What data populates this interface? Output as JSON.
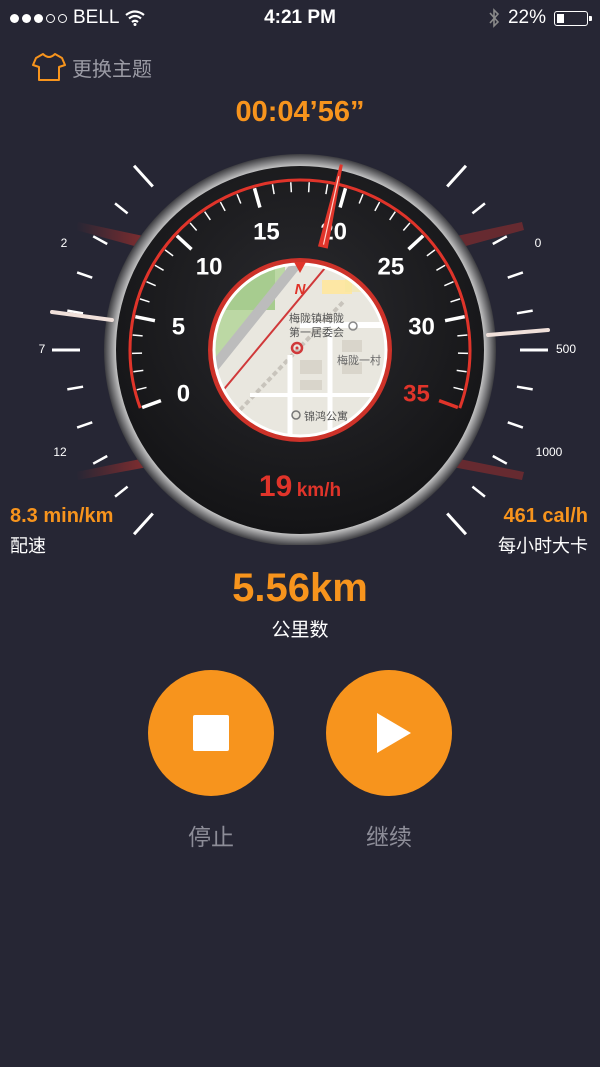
{
  "status_bar": {
    "carrier": "BELL",
    "time": "4:21 PM",
    "battery": "22%",
    "battery_level": 0.22,
    "icons": [
      "signal-dots",
      "wifi-icon",
      "bluetooth-icon",
      "battery-icon"
    ]
  },
  "theme": {
    "label": "更换主题",
    "icon": "tshirt-icon"
  },
  "timer": "00:04’56”",
  "speedometer": {
    "ticks": [
      "0",
      "5",
      "10",
      "15",
      "20",
      "25",
      "30",
      "35"
    ],
    "max": 35,
    "needle_value": 19.5,
    "compass_label": "N",
    "speed_value": "19",
    "speed_unit": "km/h",
    "left_scale": [
      "2",
      "7",
      "12"
    ],
    "right_scale": [
      "0",
      "500",
      "1000"
    ],
    "map": {
      "label_1": "梅陇镇梅陇",
      "label_2": "第一居委会",
      "label_3": "梅陇一村",
      "label_4": "锦鸿公寓"
    },
    "colors": {
      "accent": "#f7941d",
      "red": "#e0342a",
      "dial": "#1b1b1f"
    }
  },
  "stats": {
    "pace_value": "8.3 min/km",
    "pace_label": "配速",
    "cal_value": "461 cal/h",
    "cal_label": "每小时大卡"
  },
  "distance": {
    "value": "5.56km",
    "label": "公里数"
  },
  "controls": {
    "stop_label": "停止",
    "resume_label": "继续"
  }
}
